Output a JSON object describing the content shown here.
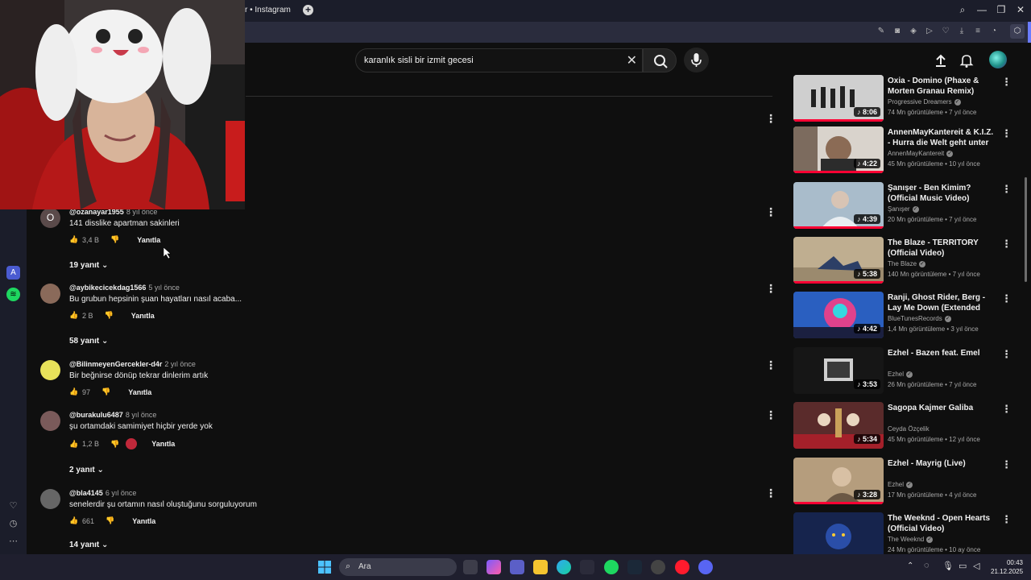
{
  "browser": {
    "tab_title": "r • Instagram",
    "new_tab_label": "+"
  },
  "youtube": {
    "search": {
      "value": "karanlık sisli bir izmit gecesi"
    }
  },
  "comments": [
    {
      "author": "@ozanayar1955",
      "time": "8 yıl önce",
      "text": "141 disslike apartman sakinleri",
      "likes": "3,4 B",
      "reply": "Yanıtla",
      "replies": "19 yanıt",
      "avatar_letter": "O"
    },
    {
      "author": "@aybikecicekdag1566",
      "time": "5 yıl önce",
      "text": "Bu grubun hepsinin şuan hayatları nasıl acaba...",
      "likes": "2 B",
      "reply": "Yanıtla",
      "replies": "58 yanıt",
      "avatar_letter": ""
    },
    {
      "author": "@BilinmeyenGercekler-d4r",
      "time": "2 yıl önce",
      "text": "Bir beğnirse dönüp tekrar dinlerim artık",
      "likes": "97",
      "reply": "Yanıtla",
      "replies": "",
      "avatar_letter": ""
    },
    {
      "author": "@burakulu6487",
      "time": "8 yıl önce",
      "text": "şu ortamdaki samimiyet hiçbir yerde yok",
      "likes": "1,2 B",
      "reply": "Yanıtla",
      "replies": "2 yanıt",
      "avatar_letter": ""
    },
    {
      "author": "@bla4145",
      "time": "6 yıl önce",
      "text": "senelerdir şu ortamın nasıl oluştuğunu sorguluyorum",
      "likes": "661",
      "reply": "Yanıtla",
      "replies": "14 yanıt",
      "avatar_letter": ""
    }
  ],
  "related": [
    {
      "title": "Oxia - Domino (Phaxe & Morten Granau Remix)",
      "channel": "Progressive Dreamers",
      "verified": true,
      "meta": "74 Mn görüntüleme • 7 yıl önce",
      "duration": "♪ 8:06",
      "thumb_color": "#c9c9c9"
    },
    {
      "title": "AnnenMayKantereit & K.I.Z. - Hurra die Welt geht unter",
      "channel": "AnnenMayKantereit",
      "verified": true,
      "meta": "45 Mn görüntüleme • 10 yıl önce",
      "duration": "♪ 4:22",
      "thumb_color": "#6e5a4e"
    },
    {
      "title": "Şanışer - Ben Kimim? (Official Music Video)",
      "channel": "Şanışer",
      "verified": true,
      "meta": "20 Mn görüntüleme • 7 yıl önce",
      "duration": "♪ 4:39",
      "thumb_color": "#9bb3c9"
    },
    {
      "title": "The Blaze - TERRITORY (Official Video)",
      "channel": "The Blaze",
      "verified": true,
      "meta": "140 Mn görüntüleme • 7 yıl önce",
      "duration": "♪ 5:38",
      "thumb_color": "#b9a98c"
    },
    {
      "title": "Ranji, Ghost Rider, Berg - Lay Me Down (Extended Version) - ...",
      "channel": "BlueTunesRecords",
      "verified": true,
      "meta": "1,4 Mn görüntüleme • 3 yıl önce",
      "duration": "♪ 4:42",
      "thumb_color": "#3a7fd8"
    },
    {
      "title": "Ezhel - Bazen feat. Emel",
      "channel": "Ezhel",
      "verified": true,
      "meta": "26 Mn görüntüleme • 7 yıl önce",
      "duration": "♪ 3:53",
      "thumb_color": "#1a1a1a"
    },
    {
      "title": "Sagopa Kajmer Galiba",
      "channel": "Ceyda Özçelik",
      "verified": false,
      "meta": "45 Mn görüntüleme • 12 yıl önce",
      "duration": "♪ 5:34",
      "thumb_color": "#7a3b3b"
    },
    {
      "title": "Ezhel - Mayrig (Live)",
      "channel": "Ezhel",
      "verified": true,
      "meta": "17 Mn görüntüleme • 4 yıl önce",
      "duration": "♪ 3:28",
      "thumb_color": "#a48a6c"
    },
    {
      "title": "The Weeknd - Open Hearts (Official Video)",
      "channel": "The Weeknd",
      "verified": true,
      "meta": "24 Mn görüntüleme • 10 ay önce",
      "duration": "",
      "thumb_color": "#1d3a8a"
    }
  ],
  "taskbar": {
    "search_placeholder": "Ara",
    "time": "00:43",
    "date": "21.12.2025"
  },
  "colors": {
    "background": "#0f0f0f",
    "accent_red": "#ff0033",
    "spotify_green": "#1ed760"
  },
  "icons": {
    "mic": "microphone-icon",
    "search": "search-icon",
    "clear": "close-icon",
    "upload": "upload-icon",
    "bell": "bell-icon"
  }
}
